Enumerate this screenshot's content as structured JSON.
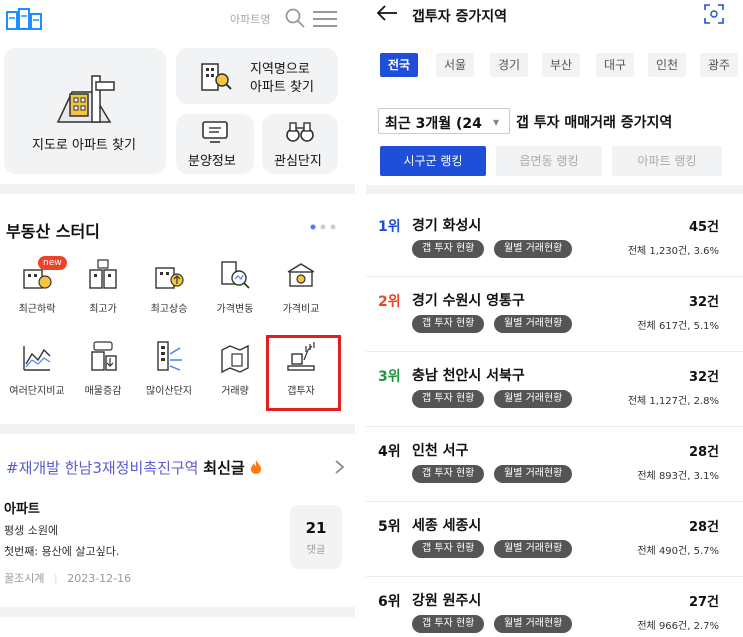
{
  "left": {
    "header": {
      "search_label": "아파트명"
    },
    "cards": {
      "map": "지도로 아파트 찾기",
      "region_line1": "지역명으로",
      "region_line2": "아파트 찾기",
      "presale": "분양정보",
      "favorites": "관심단지"
    },
    "study": {
      "title": "부동산 스터디",
      "new_badge": "new",
      "items": [
        {
          "label": "최근하락",
          "icon": "price-down-icon"
        },
        {
          "label": "최고가",
          "icon": "highest-price-icon"
        },
        {
          "label": "최고상승",
          "icon": "price-up-icon"
        },
        {
          "label": "가격변동",
          "icon": "price-change-icon"
        },
        {
          "label": "가격비교",
          "icon": "price-compare-icon"
        },
        {
          "label": "여러단지비교",
          "icon": "multi-compare-icon"
        },
        {
          "label": "매물증감",
          "icon": "listing-change-icon"
        },
        {
          "label": "많이산단지",
          "icon": "popular-complex-icon"
        },
        {
          "label": "거래량",
          "icon": "trade-volume-icon"
        },
        {
          "label": "갭투자",
          "icon": "gap-invest-icon"
        }
      ]
    },
    "post": {
      "hashtag": "#재개발 한남3재정비촉진구역",
      "suffix": "최신글",
      "category": "아파트",
      "line1": "평생 소원에",
      "line2": "첫번째: 용산에 살고싶다.",
      "author": "꿀조시계",
      "date": "2023-12-16",
      "comment_count": "21",
      "comment_label": "댓글"
    }
  },
  "right": {
    "title": "갭투자 증가지역",
    "regions": [
      "전국",
      "서울",
      "경기",
      "부산",
      "대구",
      "인천",
      "광주"
    ],
    "period_value": "최근 3개월 (24",
    "period_suffix": "갭 투자 매매거래 증가지역",
    "rank_tabs": [
      "시구군 랭킹",
      "읍면동 랭킹",
      "아파트 랭킹"
    ],
    "pill_gap": "갭 투자 현황",
    "pill_monthly": "월별 거래현황",
    "rows": [
      {
        "rank": "1위",
        "name": "경기 화성시",
        "count": "45건",
        "total": "전체 1,230건, 3.6%",
        "color": "#1f4fd8"
      },
      {
        "rank": "2위",
        "name": "경기 수원시 영통구",
        "count": "32건",
        "total": "전체 617건, 5.1%",
        "color": "#e8452c"
      },
      {
        "rank": "3위",
        "name": "충남 천안시 서북구",
        "count": "32건",
        "total": "전체 1,127건, 2.8%",
        "color": "#1a9a3a"
      },
      {
        "rank": "4위",
        "name": "인천 서구",
        "count": "28건",
        "total": "전체 893건, 3.1%",
        "color": "#111111"
      },
      {
        "rank": "5위",
        "name": "세종 세종시",
        "count": "28건",
        "total": "전체 490건, 5.7%",
        "color": "#111111"
      },
      {
        "rank": "6위",
        "name": "강원 원주시",
        "count": "27건",
        "total": "전체 966건, 2.7%",
        "color": "#111111"
      }
    ]
  }
}
